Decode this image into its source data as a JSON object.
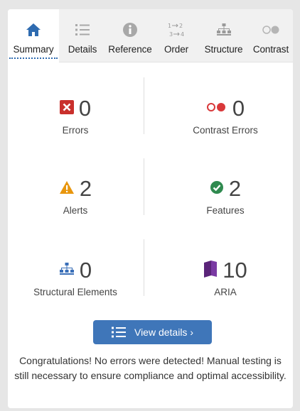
{
  "tabs": [
    {
      "label": "Summary",
      "icon": "home-icon",
      "active": true
    },
    {
      "label": "Details",
      "icon": "list-icon"
    },
    {
      "label": "Reference",
      "icon": "info-icon"
    },
    {
      "label": "Order",
      "icon": "order-icon"
    },
    {
      "label": "Structure",
      "icon": "structure-icon"
    },
    {
      "label": "Contrast",
      "icon": "contrast-icon"
    }
  ],
  "summary": {
    "errors": {
      "count": "0",
      "label": "Errors",
      "icon": "error-icon",
      "color": "#c9302c"
    },
    "contrast_errors": {
      "count": "0",
      "label": "Contrast Errors",
      "icon": "contrast-error-icon",
      "color": "#d9383a"
    },
    "alerts": {
      "count": "2",
      "label": "Alerts",
      "icon": "alert-icon",
      "color": "#e8960e"
    },
    "features": {
      "count": "2",
      "label": "Features",
      "icon": "feature-icon",
      "color": "#2f8a4f"
    },
    "structural": {
      "count": "0",
      "label": "Structural Elements",
      "icon": "structure-icon",
      "color": "#3a6fb8"
    },
    "aria": {
      "count": "10",
      "label": "ARIA",
      "icon": "aria-icon",
      "color": "#6a2c8f"
    }
  },
  "details_button": {
    "label": "View details ›"
  },
  "message": "Congratulations! No errors were detected! Manual testing is still necessary to ensure compliance and optimal accessibility."
}
